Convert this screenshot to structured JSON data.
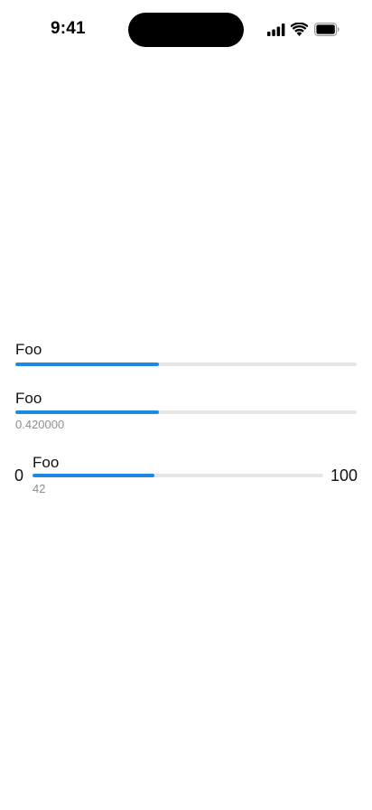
{
  "status_bar": {
    "time": "9:41",
    "signal_icon": "cellular-signal-icon",
    "wifi_icon": "wifi-icon",
    "battery_icon": "battery-icon"
  },
  "progress_1": {
    "label": "Foo",
    "value": 0.42,
    "fill_color": "#1e88e5",
    "track_color": "#e6e6e6"
  },
  "progress_2": {
    "label": "Foo",
    "value": 0.42,
    "value_text": "0.420000",
    "fill_color": "#1e88e5",
    "track_color": "#e6e6e6"
  },
  "progress_3": {
    "label": "Foo",
    "value": 42,
    "min": 0,
    "max": 100,
    "min_label": "0",
    "max_label": "100",
    "value_text": "42",
    "fill_color": "#1e88e5",
    "track_color": "#e6e6e6"
  }
}
